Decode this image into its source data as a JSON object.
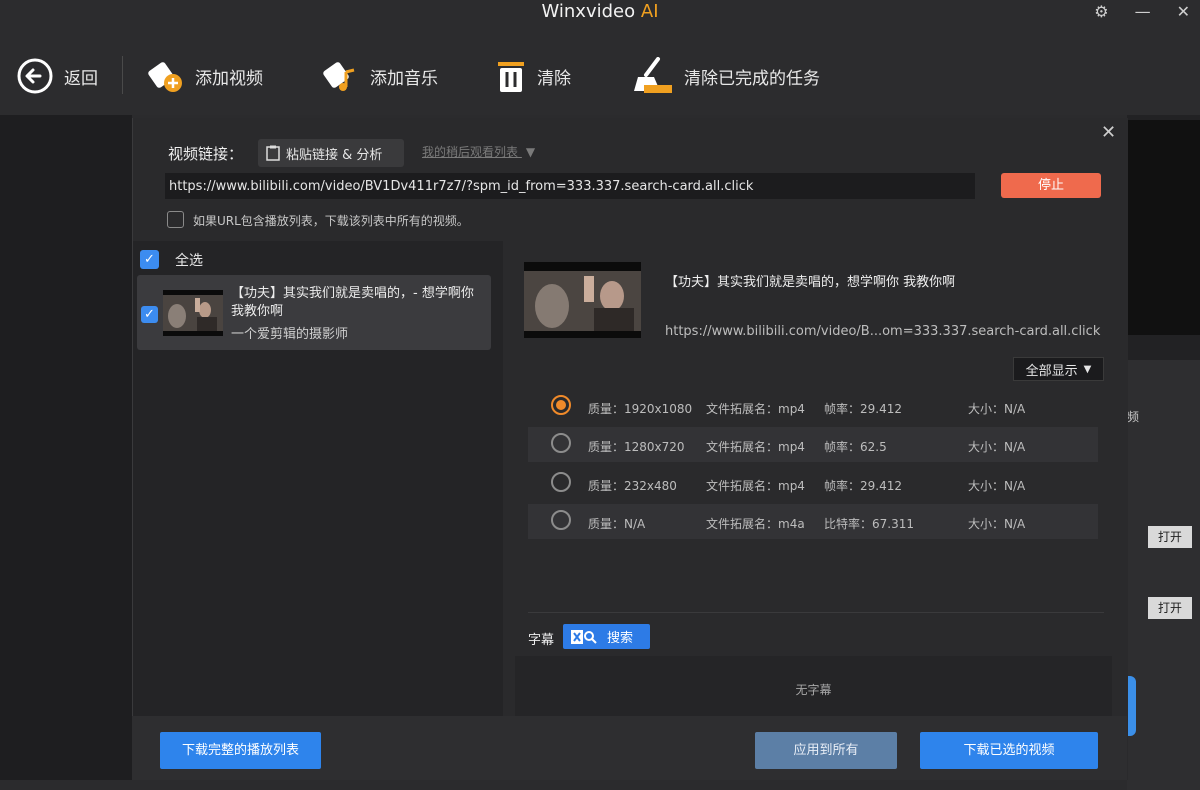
{
  "app": {
    "title_main": "Winxvideo",
    "title_ai": "AI"
  },
  "toolbar": {
    "back_label": "返回",
    "add_video_label": "添加视频",
    "add_music_label": "添加音乐",
    "clear_label": "清除",
    "clear_done_label": "清除已完成的任务"
  },
  "dialog": {
    "url_label": "视频链接：",
    "paste_label": "粘贴链接 & 分析",
    "history_label": "我的稍后观看列表",
    "url_value": "https://www.bilibili.com/video/BV1Dv411r7z7/?spm_id_from=333.337.search-card.all.click",
    "stop_label": "停止",
    "playlist_option": "如果URL包含播放列表，下载该列表中所有的视频。",
    "select_all": "全选",
    "item": {
      "title": "【功夫】其实我们就是卖唱的，- 想学啊你 我教你啊",
      "author": "一个爱剪辑的摄影师"
    },
    "detail": {
      "title": "【功夫】其实我们就是卖唱的，想学啊你 我教你啊",
      "url": "https://www.bilibili.com/video/B...om=333.337.search-card.all.click",
      "show_all": "全部显示",
      "formats": [
        {
          "quality": "质量：1920x1080",
          "ext": "文件拓展名：mp4",
          "rate": "帧率：29.412",
          "size": "大小：N/A",
          "selected": true
        },
        {
          "quality": "质量：1280x720",
          "ext": "文件拓展名：mp4",
          "rate": "帧率：62.5",
          "size": "大小：N/A",
          "selected": false
        },
        {
          "quality": "质量：232x480",
          "ext": "文件拓展名：mp4",
          "rate": "帧率：29.412",
          "size": "大小：N/A",
          "selected": false
        },
        {
          "quality": "质量：N/A",
          "ext": "文件拓展名：m4a",
          "rate": "比特率：67.311",
          "size": "大小：N/A",
          "selected": false
        }
      ],
      "subtitle_label": "字幕",
      "search_label": "搜索",
      "no_subtitle": "无字幕"
    },
    "buttons": {
      "download_playlist": "下载完整的播放列表",
      "apply_all": "应用到所有",
      "download_selected": "下载已选的视频"
    }
  },
  "background": {
    "open_label": "打开",
    "frag_char": "频"
  },
  "colors": {
    "accent_blue": "#2e84ec",
    "accent_orange": "#f08a2a",
    "stop_red": "#ef6a4d"
  }
}
